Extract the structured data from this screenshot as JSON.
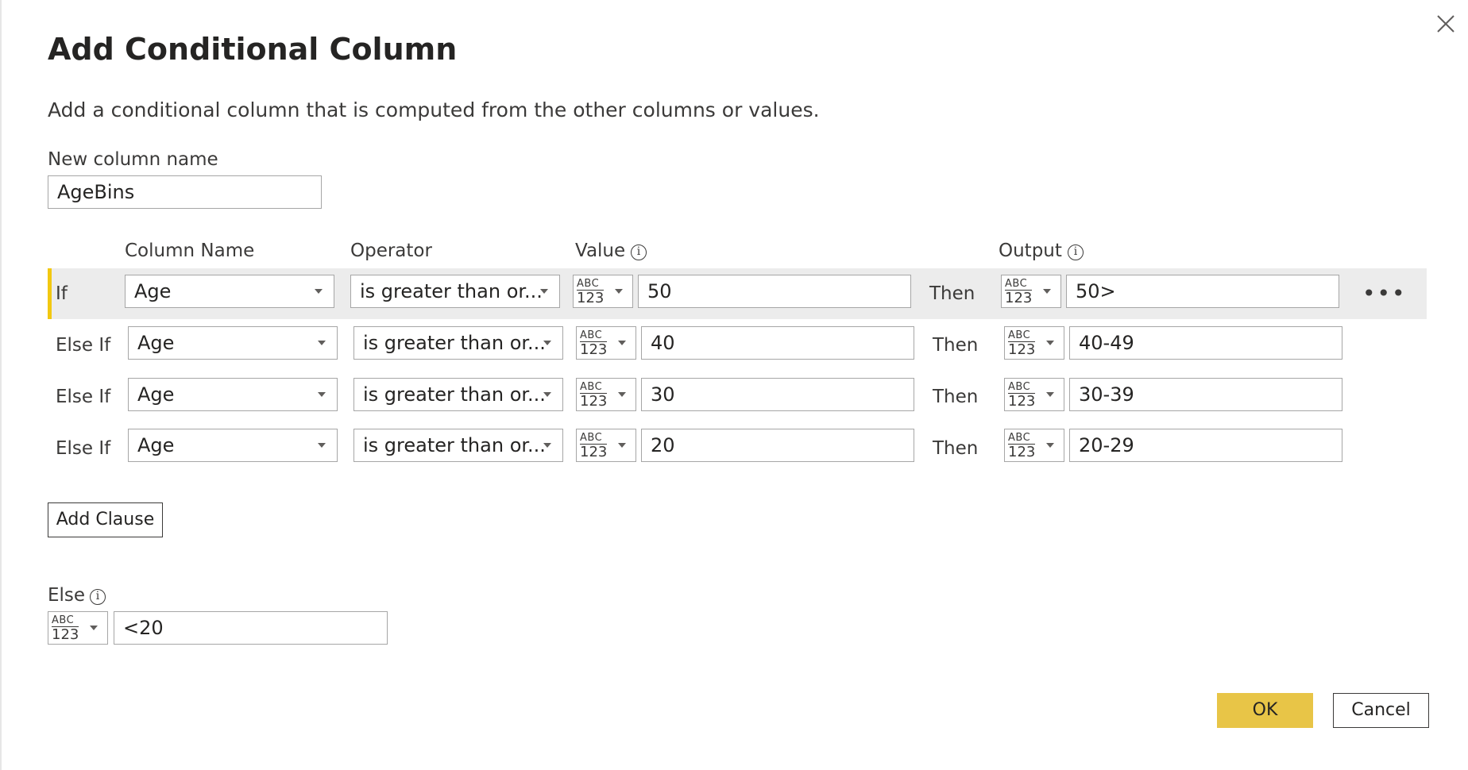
{
  "dialog": {
    "title": "Add Conditional Column",
    "description": "Add a conditional column that is computed from the other columns or values.",
    "new_column_label": "New column name",
    "new_column_value": "AgeBins"
  },
  "headers": {
    "column_name": "Column Name",
    "operator": "Operator",
    "value": "Value",
    "output": "Output"
  },
  "type_icon": {
    "abc": "ABC",
    "num": "123"
  },
  "rows": [
    {
      "keyword": "If",
      "column": "Age",
      "operator": "is greater than or...",
      "value": "50",
      "then": "Then",
      "output": "50>",
      "selected": true
    },
    {
      "keyword": "Else If",
      "column": "Age",
      "operator": "is greater than or...",
      "value": "40",
      "then": "Then",
      "output": "40-49",
      "selected": false
    },
    {
      "keyword": "Else If",
      "column": "Age",
      "operator": "is greater than or...",
      "value": "30",
      "then": "Then",
      "output": "30-39",
      "selected": false
    },
    {
      "keyword": "Else If",
      "column": "Age",
      "operator": "is greater than or...",
      "value": "20",
      "then": "Then",
      "output": "20-29",
      "selected": false
    }
  ],
  "more_label": "•••",
  "add_clause_label": "Add Clause",
  "else": {
    "label": "Else",
    "value": "<20"
  },
  "buttons": {
    "ok": "OK",
    "cancel": "Cancel"
  },
  "info_glyph": "i",
  "colors": {
    "accent": "#f2c811",
    "ok_button": "#e8c547",
    "selected_row": "#ececec"
  }
}
